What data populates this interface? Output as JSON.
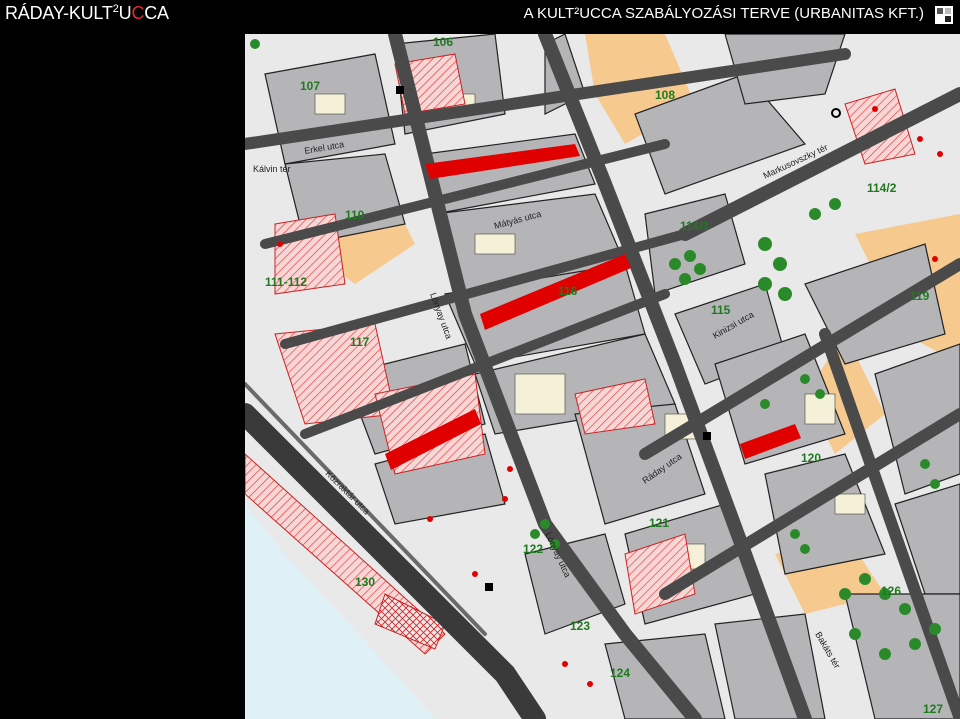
{
  "header": {
    "brand_before": "RÁDAY-KULT",
    "brand_sup": "2",
    "brand_u": "U",
    "brand_c_red": "C",
    "brand_after": "CA",
    "plan_title": "A KULT²UCCA SZABÁLYOZÁSI TERVE (URBANITAS KFT.)"
  },
  "icons": {
    "corner": "expand-icon"
  },
  "colors": {
    "background": "#000000",
    "street": "#4a4a4a",
    "street_dark": "#2f2f2f",
    "building": "#b5b5b8",
    "courtyard": "#f5f1d8",
    "hatch_red": "#e23a3a",
    "highlight_red": "#e00000",
    "tree_green": "#2a8a2a",
    "block_label": "#1f7a1f",
    "water": "#dff0f7",
    "orange_zone": "#f6c98f"
  },
  "map": {
    "block_labels": [
      "106",
      "107",
      "108",
      "110",
      "111-112",
      "114/1",
      "114/2",
      "115",
      "116",
      "117",
      "119",
      "120",
      "121",
      "122",
      "123",
      "124",
      "126",
      "127",
      "130"
    ],
    "street_labels": [
      "Kálvin tér",
      "Lónyay utca",
      "Kinizsi utca",
      "Ráday utca",
      "Közraktár utca",
      "Markusovszky tér",
      "Mátyás utca",
      "Erkel utca",
      "Bakáts tér"
    ]
  }
}
